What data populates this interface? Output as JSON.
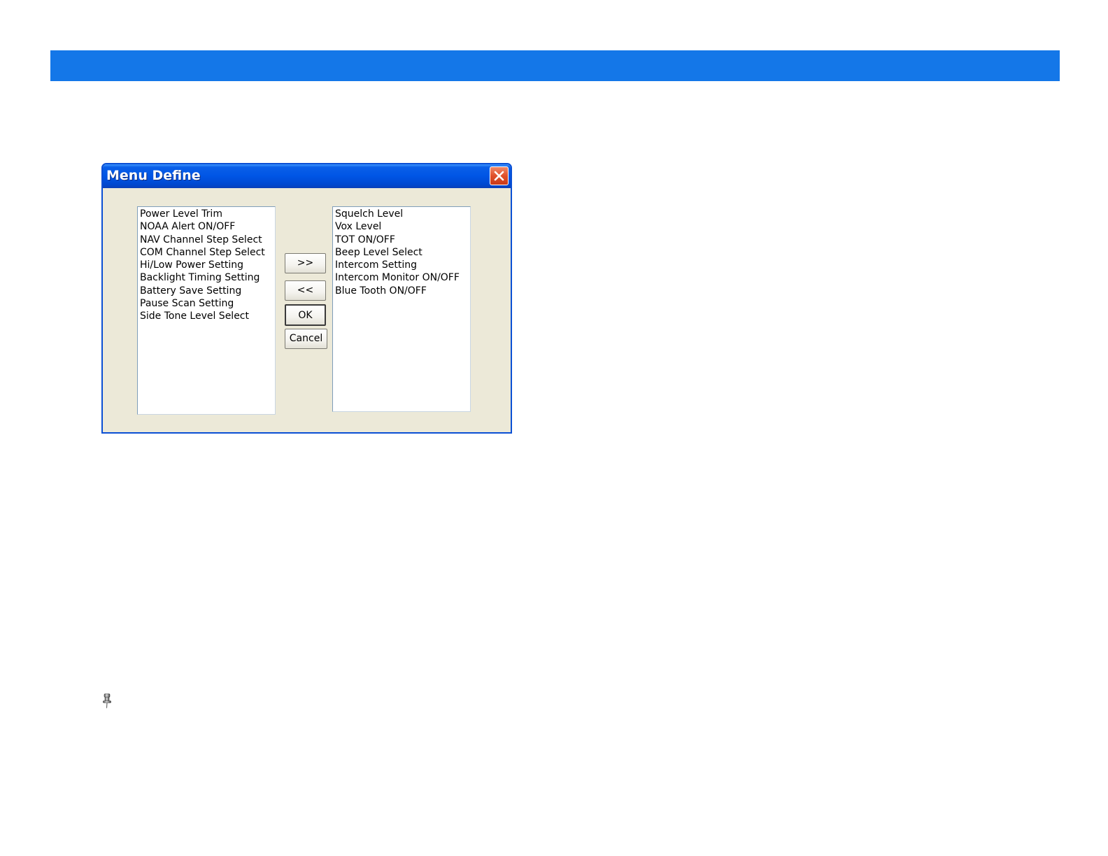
{
  "dialog": {
    "title": "Menu Define",
    "close_icon": "close-icon",
    "available_items": [
      "Power Level Trim",
      "NOAA Alert ON/OFF",
      "NAV Channel Step Select",
      "COM Channel Step Select",
      "Hi/Low Power Setting",
      "Backlight Timing Setting",
      "Battery Save Setting",
      "Pause Scan Setting",
      "Side Tone Level Select"
    ],
    "selected_items": [
      "Squelch Level",
      "Vox Level",
      "TOT ON/OFF",
      "Beep Level Select",
      "Intercom Setting",
      "Intercom Monitor ON/OFF",
      "Blue Tooth ON/OFF"
    ],
    "buttons": {
      "add": ">>",
      "remove": "<<",
      "ok": "OK",
      "cancel": "Cancel"
    }
  },
  "colors": {
    "banner": "#1477e8",
    "titlebar": "#0055e5",
    "dialog_bg": "#ece9d8"
  },
  "icons": {
    "note": "pushpin-icon"
  }
}
